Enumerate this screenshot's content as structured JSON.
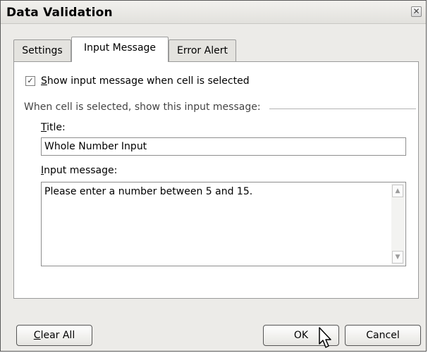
{
  "dialog": {
    "title": "Data Validation",
    "close_glyph": "✕"
  },
  "tabs": [
    {
      "label": "Settings",
      "active": false
    },
    {
      "label": "Input Message",
      "active": true
    },
    {
      "label": "Error Alert",
      "active": false
    }
  ],
  "input_message": {
    "show_checkbox": {
      "checked": true,
      "label_mnemonic": "S",
      "label_rest": "how input message when cell is selected"
    },
    "group_label": "When cell is selected, show this input message:",
    "title_label_mnemonic": "T",
    "title_label_rest": "itle:",
    "title_value": "Whole Number Input",
    "message_label_mnemonic": "I",
    "message_label_rest": "nput message:",
    "message_value": "Please enter a number between 5 and 15."
  },
  "buttons": {
    "clear_all_mnemonic": "C",
    "clear_all_rest": "lear All",
    "ok": "OK",
    "cancel": "Cancel"
  },
  "icons": {
    "close": "close-icon",
    "check": "checkmark-icon",
    "scroll_up": "scroll-up-icon",
    "scroll_down": "scroll-down-icon",
    "cursor": "mouse-pointer-icon"
  }
}
